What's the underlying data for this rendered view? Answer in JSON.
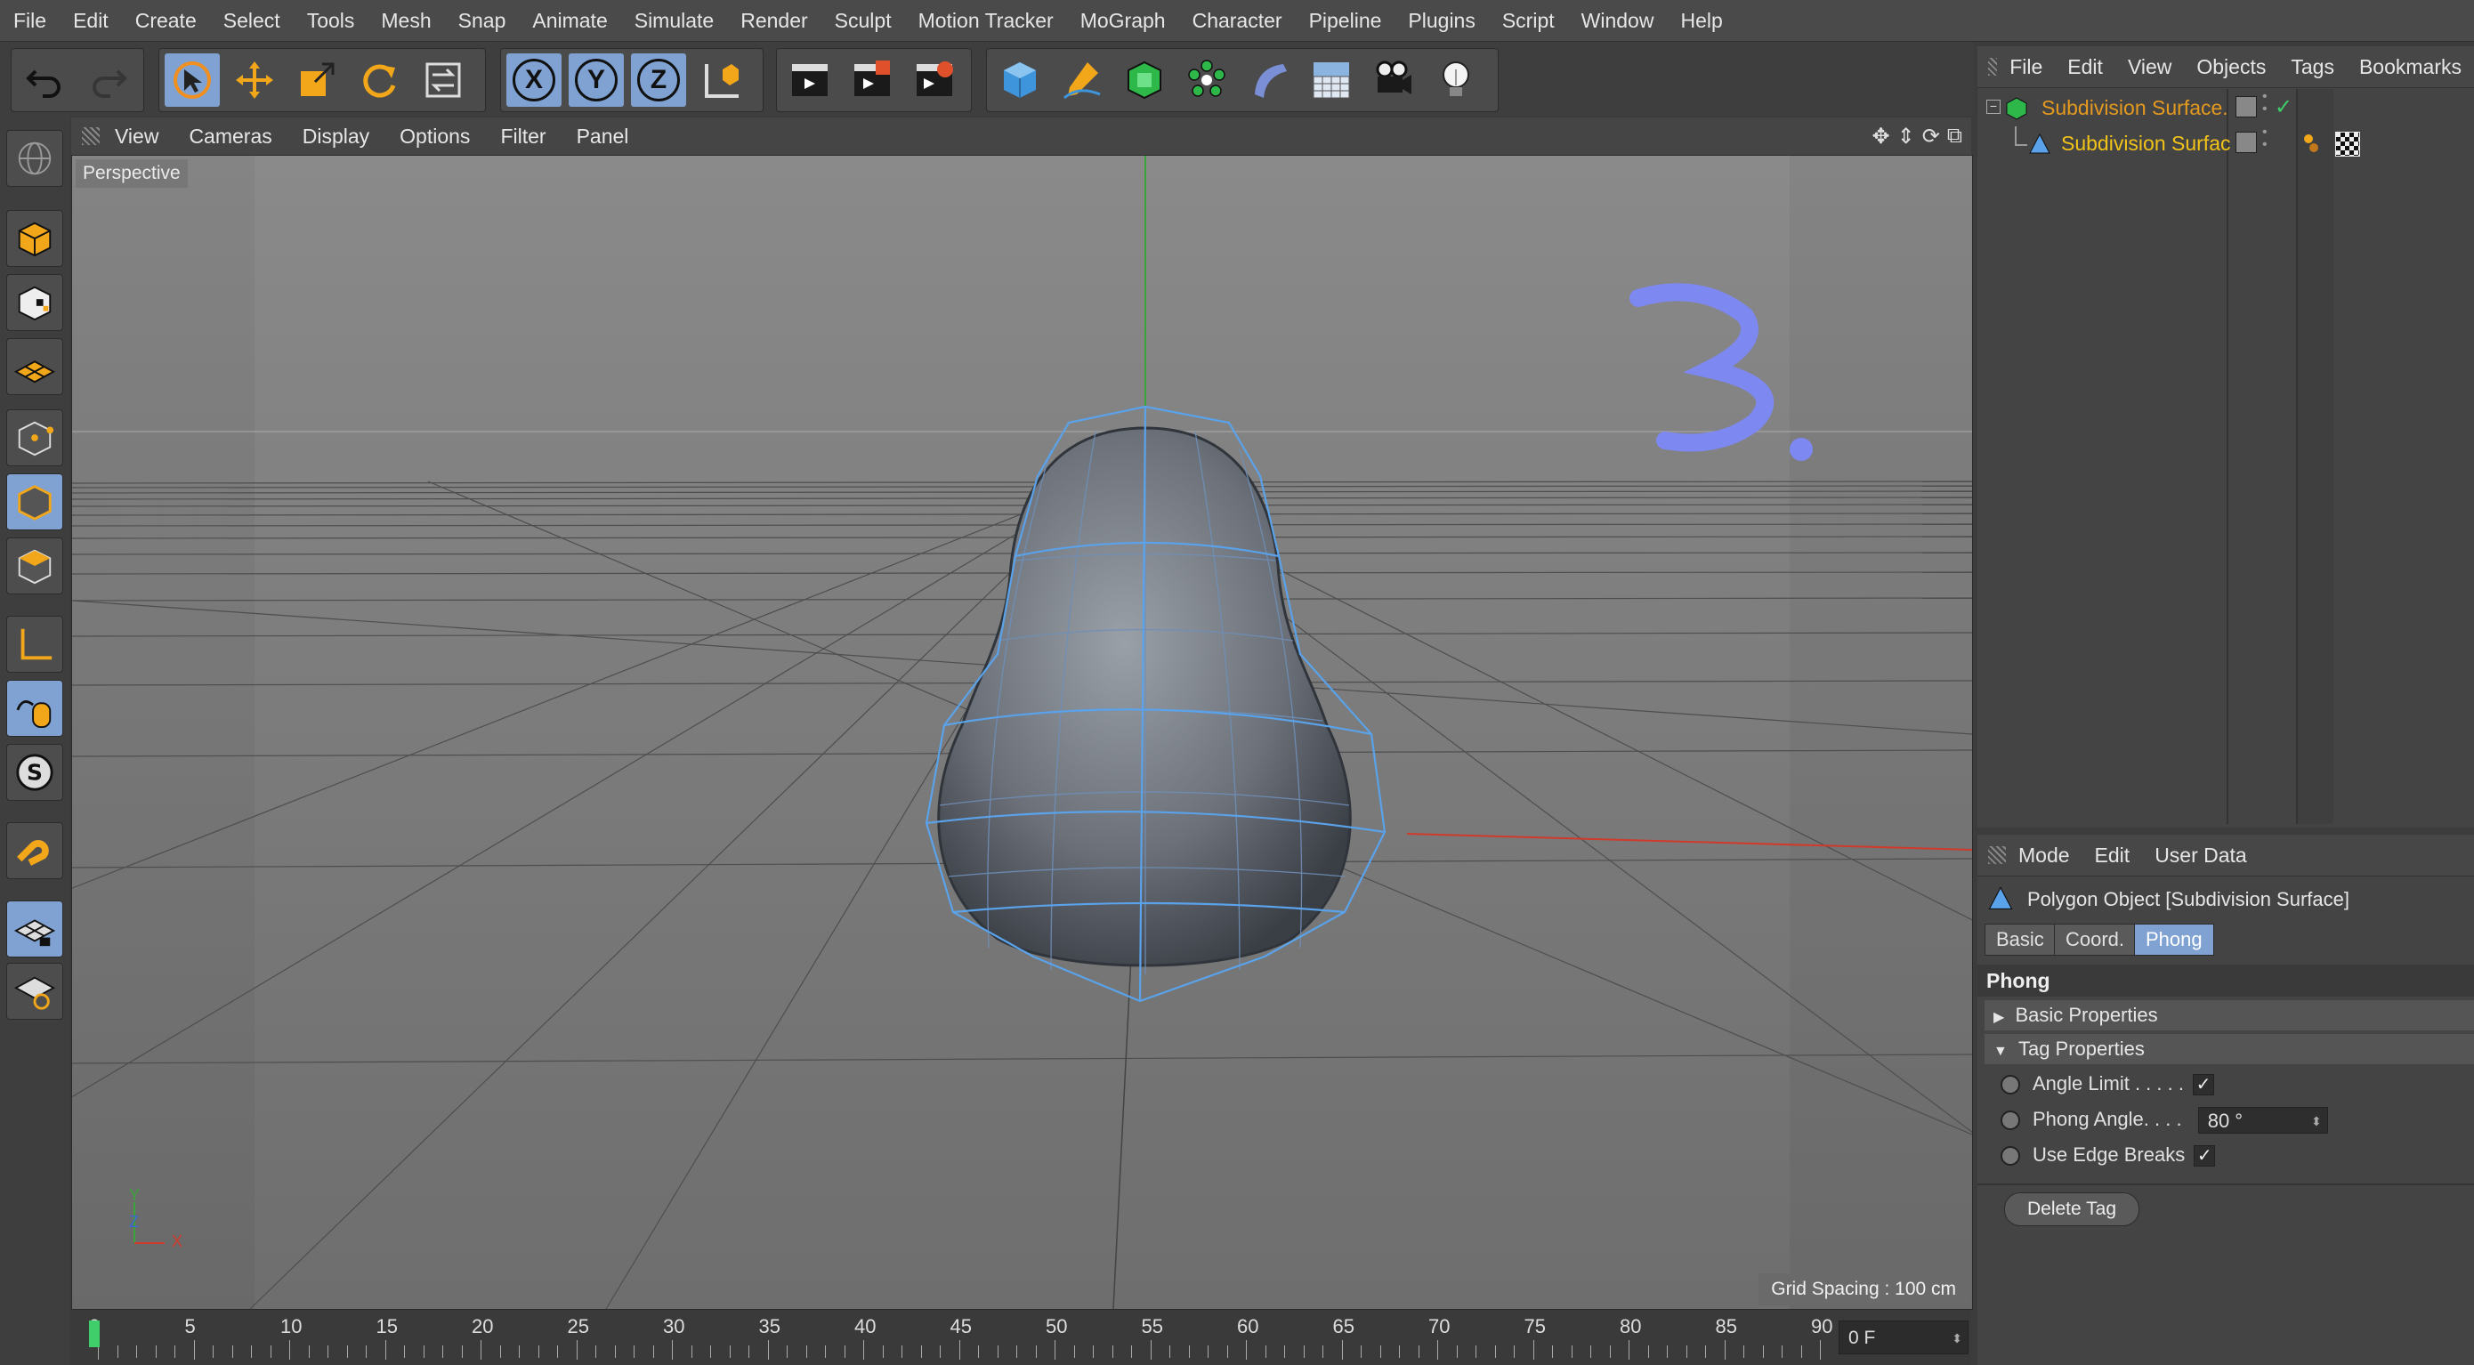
{
  "menubar": [
    "File",
    "Edit",
    "Create",
    "Select",
    "Tools",
    "Mesh",
    "Snap",
    "Animate",
    "Simulate",
    "Render",
    "Sculpt",
    "Motion Tracker",
    "MoGraph",
    "Character",
    "Pipeline",
    "Plugins",
    "Script",
    "Window",
    "Help"
  ],
  "axis_buttons": {
    "x": "X",
    "y": "Y",
    "z": "Z"
  },
  "viewport": {
    "menu": [
      "View",
      "Cameras",
      "Display",
      "Options",
      "Filter",
      "Panel"
    ],
    "camera_label": "Perspective",
    "grid_spacing": "Grid Spacing : 100 cm",
    "annotation": "3.",
    "axis_gizmo": {
      "y": "Y",
      "z": "Z",
      "x": "X"
    }
  },
  "timeline": {
    "ticks": [
      "0",
      "5",
      "10",
      "15",
      "20",
      "25",
      "30",
      "35",
      "40",
      "45",
      "50",
      "55",
      "60",
      "65",
      "70",
      "75",
      "80",
      "85",
      "90"
    ],
    "current_frame": "0 F"
  },
  "object_manager": {
    "menu": [
      "File",
      "Edit",
      "View",
      "Objects",
      "Tags",
      "Bookmarks"
    ],
    "objects": [
      {
        "name": "Subdivision Surface.",
        "color": "#e59a1f"
      },
      {
        "name": "Subdivision Surfac",
        "color": "#f2c319"
      }
    ]
  },
  "attribute_manager": {
    "menu": [
      "Mode",
      "Edit",
      "User Data"
    ],
    "title": "Polygon Object [Subdivision Surface]",
    "tabs": [
      "Basic",
      "Coord.",
      "Phong"
    ],
    "active_tab": "Phong",
    "section_heading": "Phong",
    "groups": {
      "basic": "Basic Properties",
      "tag": "Tag Properties"
    },
    "properties": {
      "angle_limit": {
        "label": "Angle Limit . . . . .",
        "checked": "✓"
      },
      "phong_angle": {
        "label": "Phong Angle. . . .",
        "value": "80 °"
      },
      "edge_breaks": {
        "label": "Use Edge Breaks",
        "checked": "✓"
      }
    },
    "delete_button": "Delete Tag"
  },
  "colors": {
    "accent_blue": "#7fa2d2",
    "orange": "#f0a020",
    "axis_x": "#d03a2a",
    "axis_y": "#3aa33a",
    "annotation": "#7d88f0"
  }
}
